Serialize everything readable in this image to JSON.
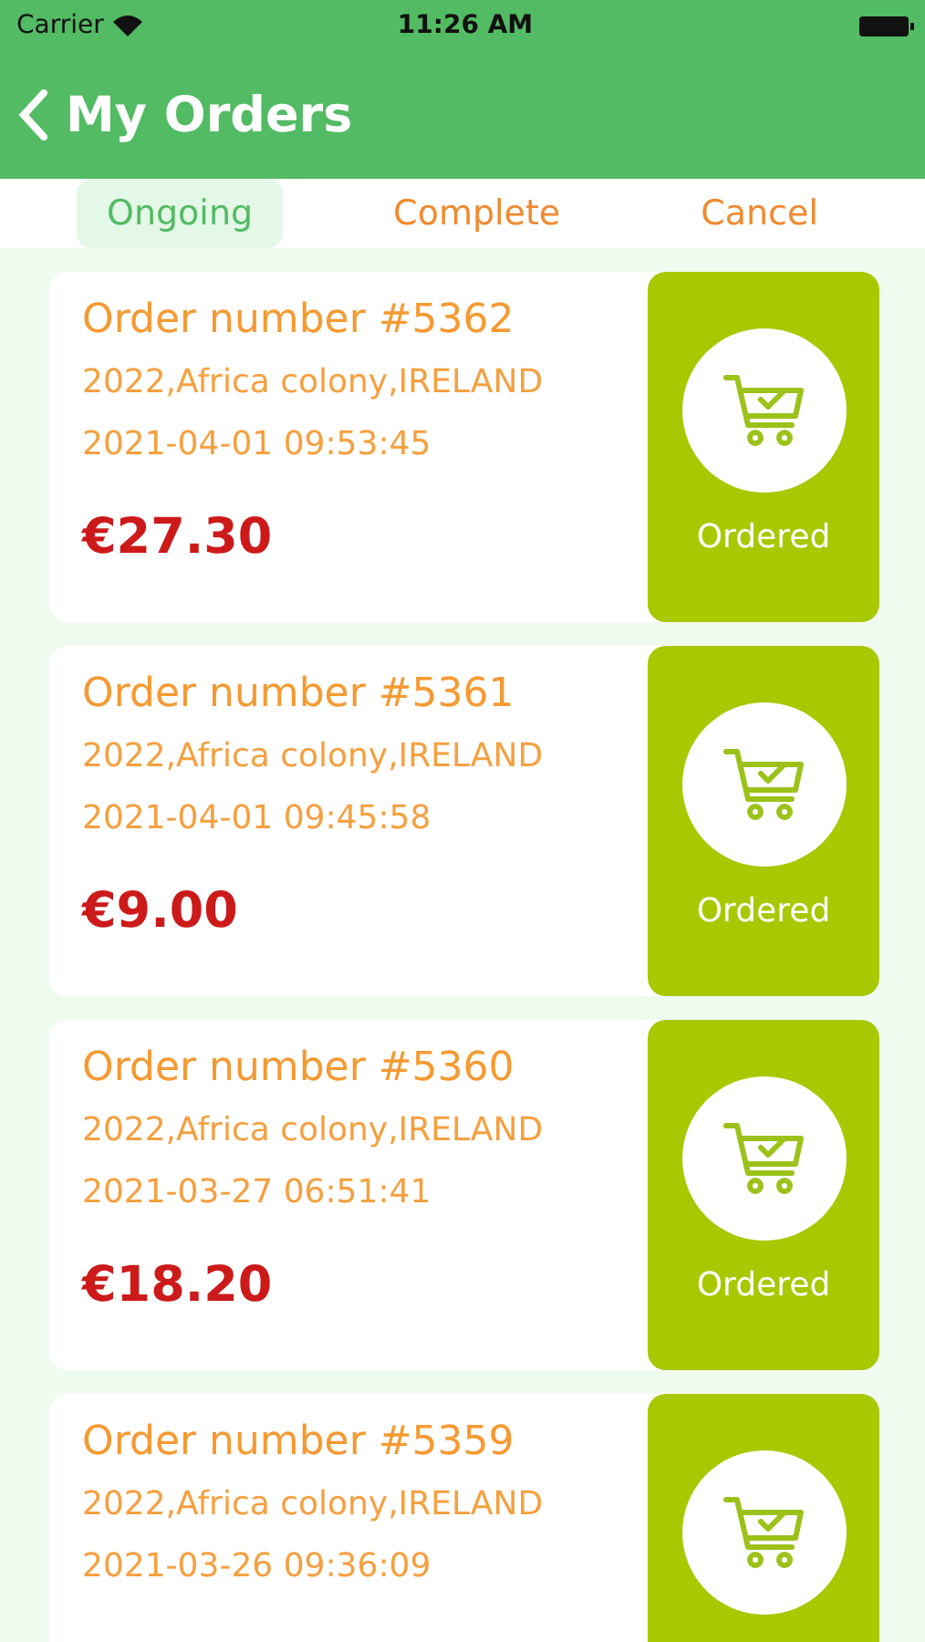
{
  "status_bar": {
    "carrier": "Carrier",
    "time": "11:26 AM"
  },
  "nav": {
    "title": "My Orders"
  },
  "tabs": [
    {
      "label": "Ongoing",
      "selected": true
    },
    {
      "label": "Complete",
      "selected": false
    },
    {
      "label": "Cancel",
      "selected": false
    }
  ],
  "orders": [
    {
      "title": "Order number #5362",
      "address": "2022,Africa colony,IRELAND",
      "date": "2021-04-01 09:53:45",
      "price": "€27.30",
      "status": "Ordered"
    },
    {
      "title": "Order number #5361",
      "address": "2022,Africa colony,IRELAND",
      "date": "2021-04-01 09:45:58",
      "price": "€9.00",
      "status": "Ordered"
    },
    {
      "title": "Order number #5360",
      "address": "2022,Africa colony,IRELAND",
      "date": "2021-03-27 06:51:41",
      "price": "€18.20",
      "status": "Ordered"
    },
    {
      "title": "Order number #5359",
      "address": "2022,Africa colony,IRELAND",
      "date": "2021-03-26 09:36:09"
    }
  ]
}
